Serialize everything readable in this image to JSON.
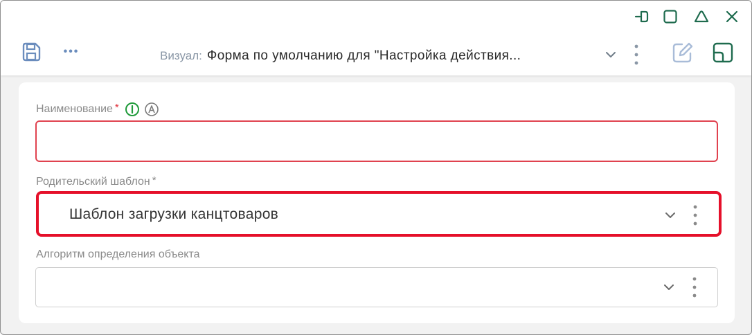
{
  "window_controls": [
    "pin-icon",
    "maximize-icon",
    "collapse-icon",
    "close-icon"
  ],
  "toolbar": {
    "save_icon": "save-icon",
    "more_label": "•••"
  },
  "visual": {
    "label": "Визуал:",
    "value": "Форма по умолчанию для \"Настройка действия..."
  },
  "form": {
    "name": {
      "label": "Наименование",
      "required": "*",
      "value": ""
    },
    "parent_template": {
      "label": "Родительский шаблон",
      "required": "*",
      "value": "Шаблон загрузки канцтоваров"
    },
    "object_algorithm": {
      "label": "Алгоритм определения объекта",
      "value": ""
    }
  },
  "colors": {
    "accent_green": "#1e6b4e",
    "error_red": "#e0424f",
    "highlight_red": "#e5102a",
    "icon_blue": "#6b8dbd"
  }
}
